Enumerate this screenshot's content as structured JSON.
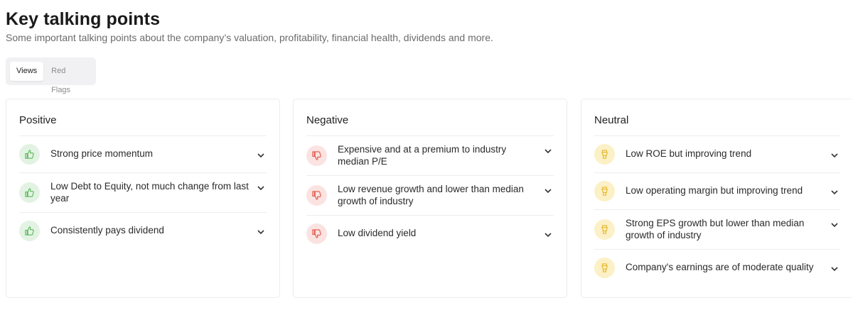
{
  "header": {
    "title": "Key talking points",
    "subtitle": "Some important talking points about the company’s valuation, profitability, financial health, dividends and more."
  },
  "tabs": [
    {
      "label": "Views",
      "active": true
    },
    {
      "label": "Red Flags",
      "active": false
    }
  ],
  "colors": {
    "positive_bg": "#e3f3e3",
    "positive_icon": "#5cb85c",
    "negative_bg": "#fbe3e1",
    "negative_icon": "#e0584b",
    "neutral_bg": "#fcf0c6",
    "neutral_icon": "#e5b72b"
  },
  "cards": {
    "positive": {
      "title": "Positive",
      "icon": "thumbs-up-icon",
      "items": [
        "Strong price momentum",
        "Low Debt to Equity, not much change from last year",
        "Consistently pays dividend"
      ]
    },
    "negative": {
      "title": "Negative",
      "icon": "thumbs-down-icon",
      "items": [
        "Expensive and at a premium to industry median P/E",
        "Low revenue growth and lower than median growth of industry",
        "Low dividend yield"
      ]
    },
    "neutral": {
      "title": "Neutral",
      "icon": "thumbs-sideways-icon",
      "items": [
        "Low ROE but improving trend",
        "Low operating margin but improving trend",
        "Strong EPS growth but lower than median growth of industry",
        "Company's earnings are of moderate quality"
      ]
    }
  }
}
